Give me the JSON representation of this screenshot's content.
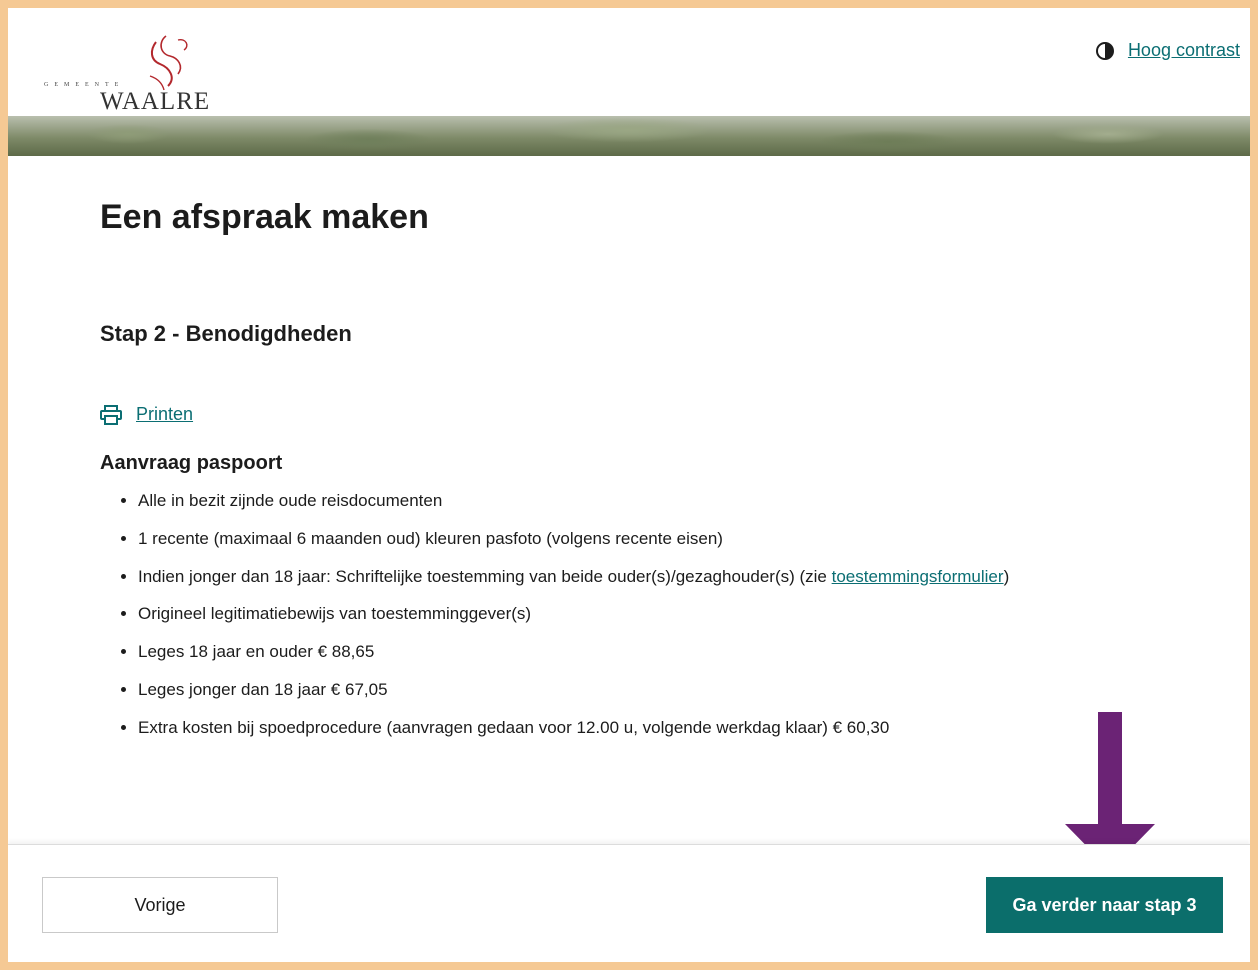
{
  "brand": {
    "logo_small": "GEMEENTE",
    "logo_name": "WAALRE"
  },
  "header": {
    "contrast_icon": "half-circle-contrast-icon",
    "contrast_label": "Hoog contrast"
  },
  "page": {
    "title": "Een afspraak maken",
    "step_title": "Stap 2 - Benodigdheden",
    "print_label": "Printen",
    "section_title": "Aanvraag paspoort",
    "items": [
      "Alle in bezit zijnde oude reisdocumenten",
      "1 recente (maximaal 6 maanden oud) kleuren pasfoto (volgens recente eisen)",
      {
        "before": "Indien jonger dan 18 jaar: Schriftelijke toestemming van beide ouder(s)/gezaghouder(s) (zie ",
        "link": "toestemmingsformulier",
        "after": ")"
      },
      "Origineel legitimatiebewijs van toestemminggever(s)",
      "Leges 18 jaar en ouder € 88,65",
      "Leges jonger dan 18 jaar € 67,05",
      "Extra kosten bij spoedprocedure (aanvragen gedaan voor 12.00 u, volgende werkdag klaar) € 60,30"
    ]
  },
  "footer": {
    "prev_label": "Vorige",
    "next_label": "Ga verder naar stap 3"
  },
  "colors": {
    "accent": "#0b6e6b",
    "link": "#0b6e73",
    "frame": "#f5c994",
    "annotation_arrow": "#6b2375"
  }
}
